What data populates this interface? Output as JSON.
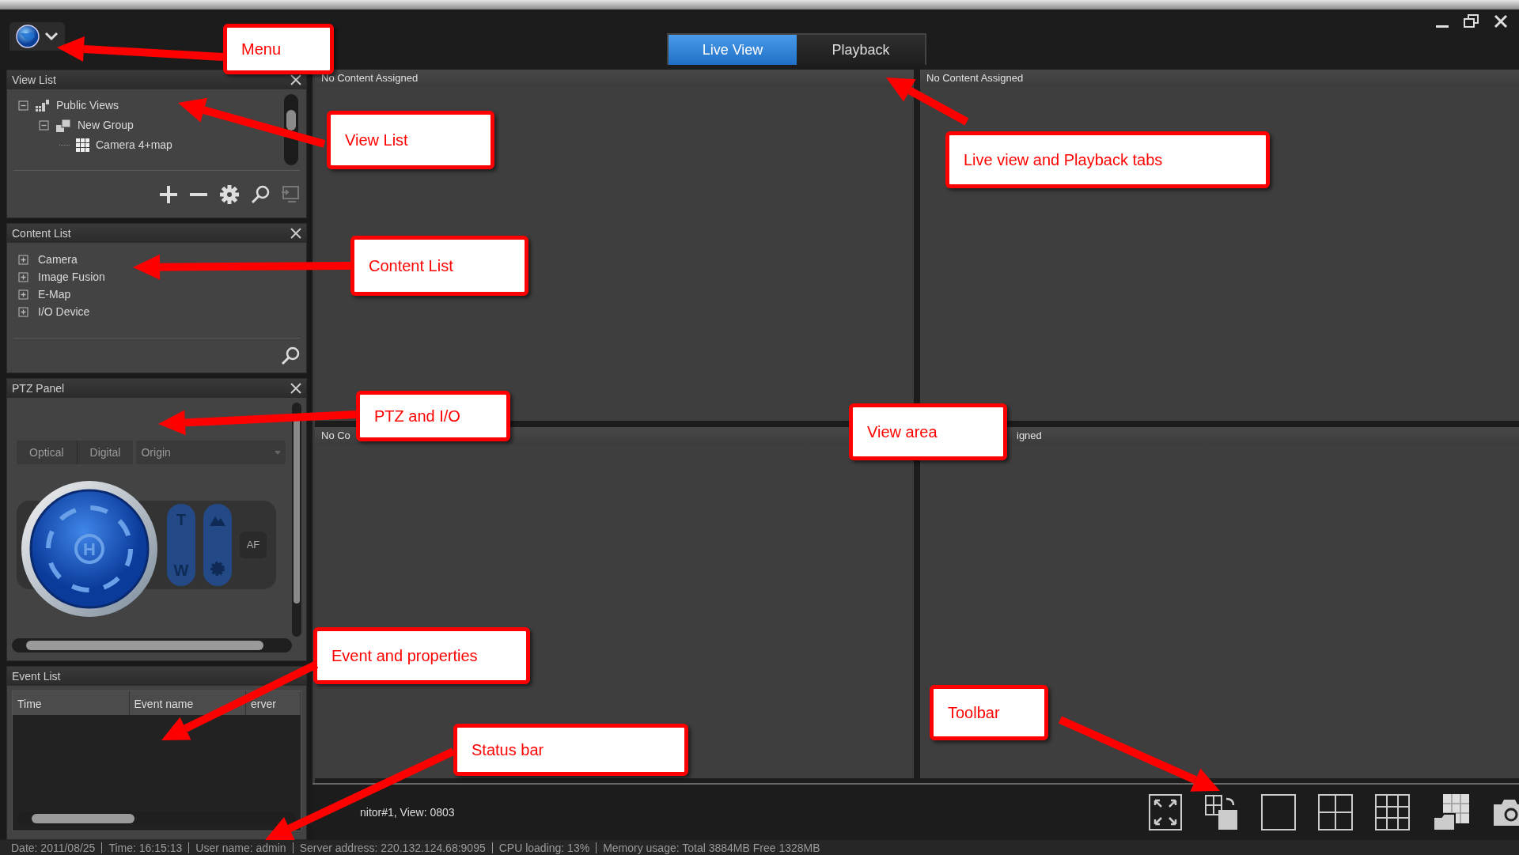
{
  "tabs": [
    {
      "label": "Live View",
      "selected": true
    },
    {
      "label": "Playback",
      "selected": false
    }
  ],
  "view_list": {
    "title": "View List",
    "tree": [
      {
        "label": "Public Views",
        "kind": "root",
        "expanded": true,
        "children": [
          {
            "label": "New Group",
            "kind": "group",
            "expanded": true,
            "children": [
              {
                "label": "Camera 4+map",
                "kind": "view"
              }
            ]
          }
        ]
      }
    ]
  },
  "content_list": {
    "title": "Content List",
    "items": [
      {
        "label": "Camera",
        "expanded": false
      },
      {
        "label": "Image Fusion",
        "expanded": false
      },
      {
        "label": "E-Map",
        "expanded": false
      },
      {
        "label": "I/O Device",
        "expanded": false
      }
    ]
  },
  "ptz_panel": {
    "title": "PTZ Panel",
    "lens_tabs": [
      {
        "label": "Optical",
        "selected": false
      },
      {
        "label": "Digital",
        "selected": false
      }
    ],
    "preset": {
      "value": "Origin"
    },
    "home_label": "H",
    "zoom_in_label": "T",
    "zoom_out_label": "W",
    "autofocus_label": "AF"
  },
  "event_list": {
    "title": "Event List",
    "columns": [
      "Time",
      "Event name",
      "erver"
    ]
  },
  "views": [
    {
      "label": "No Content Assigned"
    },
    {
      "label": "No Content Assigned"
    },
    {
      "label": "No Co"
    },
    {
      "label": "igned"
    }
  ],
  "toolbar": {
    "label": "nitor#1, View: 0803"
  },
  "status_bar": [
    "Date: 2011/08/25",
    "Time: 16:15:13",
    "User name: admin",
    "Server address: 220.132.124.68:9095",
    "CPU loading: 13%",
    "Memory usage: Total 3884MB  Free 1328MB"
  ],
  "callouts": [
    {
      "label": "Menu"
    },
    {
      "label": "View List"
    },
    {
      "label": "Live view and Playback tabs"
    },
    {
      "label": "Content List"
    },
    {
      "label": "PTZ and I/O"
    },
    {
      "label": "View area"
    },
    {
      "label": "Event and properties"
    },
    {
      "label": "Toolbar"
    },
    {
      "label": "Status bar"
    }
  ]
}
